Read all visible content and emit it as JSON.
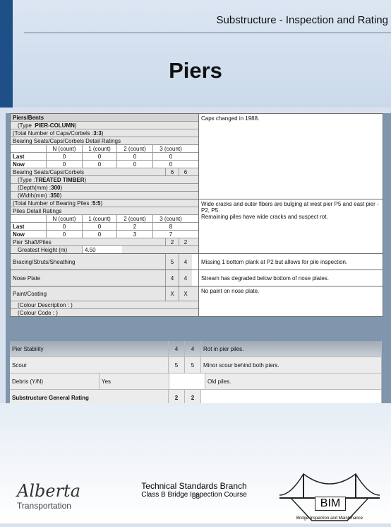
{
  "header": {
    "section_title": "Substructure - Inspection and Rating",
    "slide_title": "Piers"
  },
  "table": {
    "piers_bents": "Piers/Bents",
    "type_label": "(Type : ",
    "type_value": "PIER-COLUMN",
    "type_close": ")",
    "caps_total": "(Total Number of Caps/Corbels : ",
    "caps_total_value": "3:3",
    "caps_total_close": ")",
    "bearing_detail": "Bearing Seats/Caps/Corbels Detail Ratings",
    "count_headers": [
      "N (count)",
      "1 (count)",
      "2 (count)",
      "3 (count)"
    ],
    "last_label": "Last",
    "now_label": "Now",
    "caps_last": [
      "0",
      "0",
      "0",
      "0"
    ],
    "caps_now": [
      "0",
      "0",
      "0",
      "0"
    ],
    "bearing_seats": "Bearing Seats/Caps/Corbels",
    "bearing_seats_last": "6",
    "bearing_seats_now": "6",
    "type2_label": "(Type : ",
    "type2_value": "TREATED TIMBER",
    "type2_close": ")",
    "depth_label": "(Depth(mm) : ",
    "depth_value": "300",
    "width_label": "(Width(mm) : ",
    "width_value": "350",
    "piles_total": "(Total Number of Bearing Piles : ",
    "piles_total_value": "5:5",
    "piles_detail": "Piles Detail Ratings",
    "piles_last": [
      "0",
      "0",
      "2",
      "8"
    ],
    "piles_now": [
      "0",
      "0",
      "3",
      "7"
    ],
    "pier_shaft": "Pier Shaft/Piles",
    "pier_shaft_last": "2",
    "pier_shaft_now": "2",
    "greatest_height": "Greatest Height (m)",
    "greatest_height_value": "4.50",
    "bracing": "Bracing/Struts/Sheathing",
    "bracing_last": "5",
    "bracing_now": "4",
    "nose_plate": "Nose Plate",
    "nose_plate_last": "4",
    "nose_plate_now": "4",
    "paint": "Paint/Coating",
    "paint_last": "X",
    "paint_now": "X",
    "colour_desc": "(Colour Description : )",
    "colour_code": "(Colour Code : )",
    "comment_caps": "Caps changed in 1988.",
    "comment_piles": "Wide cracks and outer fibers are bulging at west pier P5 and east pier - P2, P5.\nRemaining piles have wide cracks and suspect rot.",
    "comment_bracing": "Missing 1 bottom plank at P2 but allows for pile inspection.",
    "comment_nose": "Stream has degraded below bottom of nose plates.",
    "comment_paint": "No paint on nose plate."
  },
  "lower": [
    {
      "label": "Pier Stability",
      "last": "4",
      "now": "4",
      "comment": "Rot in pier piles."
    },
    {
      "label": "Scour",
      "last": "5",
      "now": "5",
      "comment": "Minor scour behind both piers."
    },
    {
      "label": "Debris (Y/N)",
      "value": "Yes",
      "comment": "Old piles."
    },
    {
      "label": "Substructure General Rating",
      "last": "2",
      "now": "2",
      "comment": ""
    }
  ],
  "footer": {
    "logo_word": "Alberta",
    "logo_sub": "Transportation",
    "branch": "Technical Standards Branch",
    "course": "Class B Bridge Inspection Course",
    "page_number": "88",
    "bim_label": "BIM",
    "bim_caption": "Bridge Inspection and Maintenance"
  },
  "colors": {
    "header_blue": "#1f4f87",
    "background": "#d7e2ee"
  }
}
